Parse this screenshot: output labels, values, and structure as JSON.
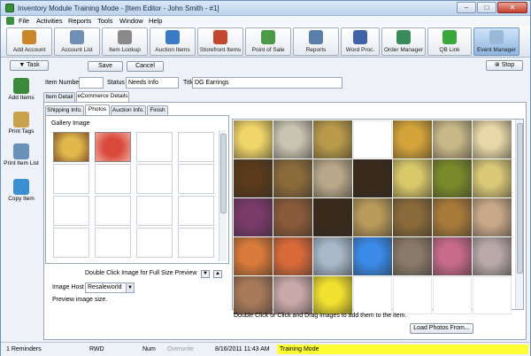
{
  "window": {
    "title": "Inventory Module Training Mode - [Item Editor - John Smith - #1]",
    "controls": [
      "–",
      "□",
      "✕"
    ]
  },
  "menu": [
    "File",
    "Activities",
    "Reports",
    "Tools",
    "Window",
    "Help"
  ],
  "toolbar": [
    {
      "label": "Add Account",
      "icon": "add-account-icon",
      "color": "#c9862b"
    },
    {
      "label": "Account List",
      "icon": "account-list-icon",
      "color": "#6f8fb5"
    },
    {
      "label": "Item Lookup",
      "icon": "magnifier-icon",
      "color": "#8a8a8a"
    },
    {
      "label": "Auction Items",
      "icon": "auction-icon",
      "color": "#3b7ac2"
    },
    {
      "label": "Storefront Items",
      "icon": "storefront-icon",
      "color": "#c4482e"
    },
    {
      "label": "Point of Sale",
      "icon": "register-icon",
      "color": "#4a9a4a"
    },
    {
      "label": "Reports",
      "icon": "reports-icon",
      "color": "#5a7fa8"
    },
    {
      "label": "Word Proc.",
      "icon": "word-processor-icon",
      "color": "#4262a8"
    },
    {
      "label": "Order Manager",
      "icon": "order-manager-icon",
      "color": "#3a8a5a"
    },
    {
      "label": "QB Link",
      "icon": "qb-link-icon",
      "color": "#39a83a"
    },
    {
      "label": "Event Manager",
      "icon": "event-manager-icon",
      "color": "#9ab8d8"
    }
  ],
  "actions": {
    "task": "Task",
    "save": "Save",
    "cancel": "Cancel",
    "stop": "Stop"
  },
  "left_nav": [
    {
      "label": "Add Items",
      "icon": "add-items-icon",
      "color": "#3a8a3a"
    },
    {
      "label": "Print Tags",
      "icon": "price-tag-icon",
      "color": "#c8a24a"
    },
    {
      "label": "Print Item List",
      "icon": "print-list-icon",
      "color": "#6a8fb8"
    },
    {
      "label": "Copy Item",
      "icon": "copy-item-icon",
      "color": "#3a8fd0"
    }
  ],
  "fields": {
    "item_number_label": "Item Number",
    "item_number_value": "",
    "status_label": "Status",
    "status_value": "Needs Info",
    "title_label": "Title",
    "title_value": "DG Earrings"
  },
  "tabs_top": [
    "Item Detail",
    "eCommerce Details"
  ],
  "tabs_sub": [
    "Shipping Info.",
    "Photos",
    "Auction Info.",
    "Finish"
  ],
  "gallery": {
    "title": "Gallery Image",
    "hint": "Double Click Image for Full Size Preview",
    "host_label": "Image Host",
    "host_value": "Resaleworld",
    "preview_text": "Preview image size.",
    "thumbnails": [
      {
        "name": "gallery-thumb-ceramic-pot",
        "colors": [
          "#e0b84c",
          "#8a5a2a"
        ]
      },
      {
        "name": "gallery-thumb-red-garment",
        "colors": [
          "#d94a3c",
          "#f2a59a"
        ]
      }
    ]
  },
  "library": {
    "hint": "Double Click or Click and Drag images to add them to the item.",
    "load_button": "Load Photos From...",
    "rows": [
      [
        "#f0d56a",
        "#c9c4b2",
        "#b89a4a",
        "#ffffff",
        "#d4a43a",
        "#c8b888",
        "#e8d8a8"
      ],
      [
        "#5a3a1a",
        "#8a6a3a",
        "#b8a88a",
        "#3a2a1a",
        "#d8c86a",
        "#7a8a2a",
        "#d8c878"
      ],
      [
        "#7a3a6a",
        "#8a5a3a",
        "#3a2a1a",
        "#b89a5a",
        "#8a6a3a",
        "#a87a3a",
        "#c8a888"
      ],
      [
        "#d87a3a",
        "#d86a3a",
        "#a8b8c8",
        "#3a8ae8",
        "#8a7a6a",
        "#c86a8a",
        "#b8a8a8"
      ],
      [
        "#a87a5a",
        "#c8a8a8",
        "#f0e030",
        "#ffffff",
        "#ffffff",
        "#ffffff",
        "#ffffff"
      ]
    ]
  },
  "status": {
    "reminders": "1 Reminders",
    "rwd": "RWD",
    "num": "Num",
    "overwrite": "Overwrite",
    "datetime": "8/16/2011 11:43 AM",
    "mode": "Training Mode"
  }
}
